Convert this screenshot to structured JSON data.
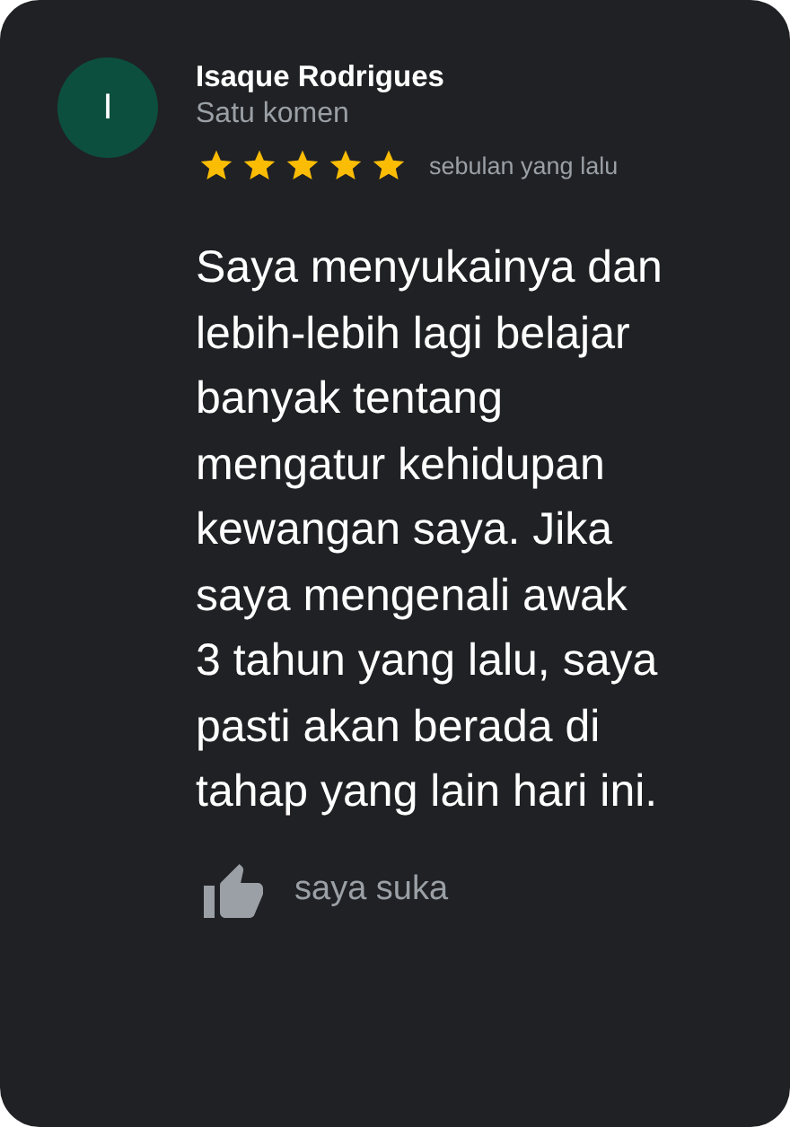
{
  "review": {
    "avatar_letter": "I",
    "author": "Isaque Rodrigues",
    "author_meta": "Satu komen",
    "stars": 5,
    "time": "sebulan yang lalu",
    "text": "Saya menyukainya dan\nlebih-lebih lagi belajar\nbanyak tentang\nmengatur kehidupan\nkewangan saya. Jika\nsaya mengenali awak\n3 tahun yang lalu, saya\npasti akan berada di\ntahap yang lain hari ini.",
    "like_label": "saya suka"
  }
}
